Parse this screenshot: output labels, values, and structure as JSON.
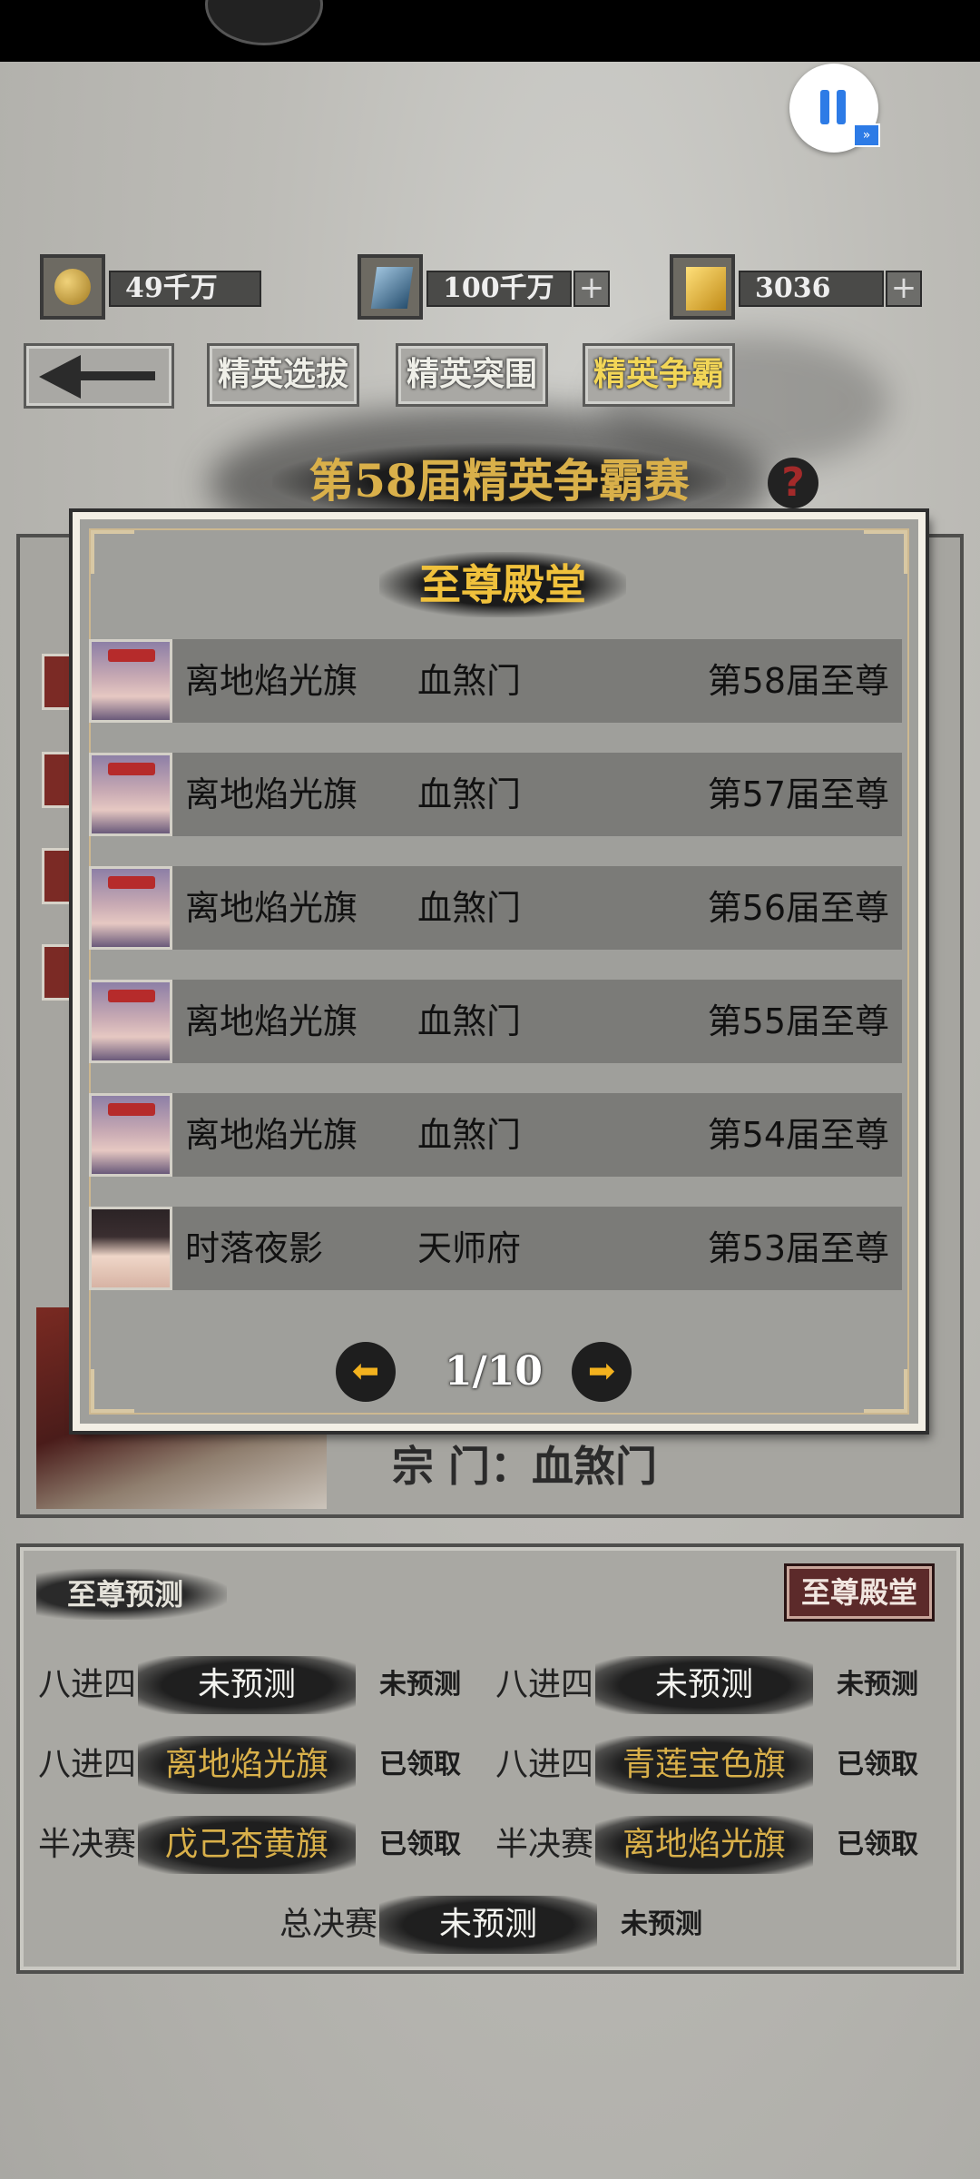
{
  "resources": [
    {
      "icon": "yin-yang-icon",
      "value": "49千万",
      "has_plus": false
    },
    {
      "icon": "blue-crystal-icon",
      "value": "100千万",
      "has_plus": true
    },
    {
      "icon": "gold-ingot-icon",
      "value": "3036",
      "has_plus": true
    }
  ],
  "nav": {
    "back": "back-arrow",
    "tabs": [
      "精英选拔",
      "精英突围",
      "精英争霸"
    ],
    "active_tab": "精英争霸"
  },
  "season_title": "第58届精英争霸赛",
  "help_symbol": "?",
  "under_panel": {
    "sect_line": "宗 门：血煞门"
  },
  "hall_of_fame": {
    "title": "至尊殿堂",
    "rows": [
      {
        "name": "离地焰光旗",
        "sect": "血煞门",
        "title": "第58届至尊"
      },
      {
        "name": "离地焰光旗",
        "sect": "血煞门",
        "title": "第57届至尊"
      },
      {
        "name": "离地焰光旗",
        "sect": "血煞门",
        "title": "第56届至尊"
      },
      {
        "name": "离地焰光旗",
        "sect": "血煞门",
        "title": "第55届至尊"
      },
      {
        "name": "离地焰光旗",
        "sect": "血煞门",
        "title": "第54届至尊"
      },
      {
        "name": "时落夜影",
        "sect": "天师府",
        "title": "第53届至尊"
      }
    ],
    "page": "1/10",
    "prev_glyph": "⬅",
    "next_glyph": "➡"
  },
  "prediction": {
    "title": "至尊预测",
    "hall_button": "至尊殿堂",
    "rows": [
      {
        "round": "八进四",
        "pick": "未预测",
        "status": "未预测",
        "gold": false
      },
      {
        "round": "八进四",
        "pick": "未预测",
        "status": "未预测",
        "gold": false
      },
      {
        "round": "八进四",
        "pick": "离地焰光旗",
        "status": "已领取",
        "gold": true
      },
      {
        "round": "八进四",
        "pick": "青莲宝色旗",
        "status": "已领取",
        "gold": true
      },
      {
        "round": "半决赛",
        "pick": "戊己杏黄旗",
        "status": "已领取",
        "gold": true
      },
      {
        "round": "半决赛",
        "pick": "离地焰光旗",
        "status": "已领取",
        "gold": true
      },
      {
        "round": "总决赛",
        "pick": "未预测",
        "status": "未预测",
        "gold": false
      }
    ]
  },
  "colors": {
    "gold_text": "#d9b04a",
    "accent_blue": "#2d7be6",
    "hall_button": "#5c2a2a"
  }
}
